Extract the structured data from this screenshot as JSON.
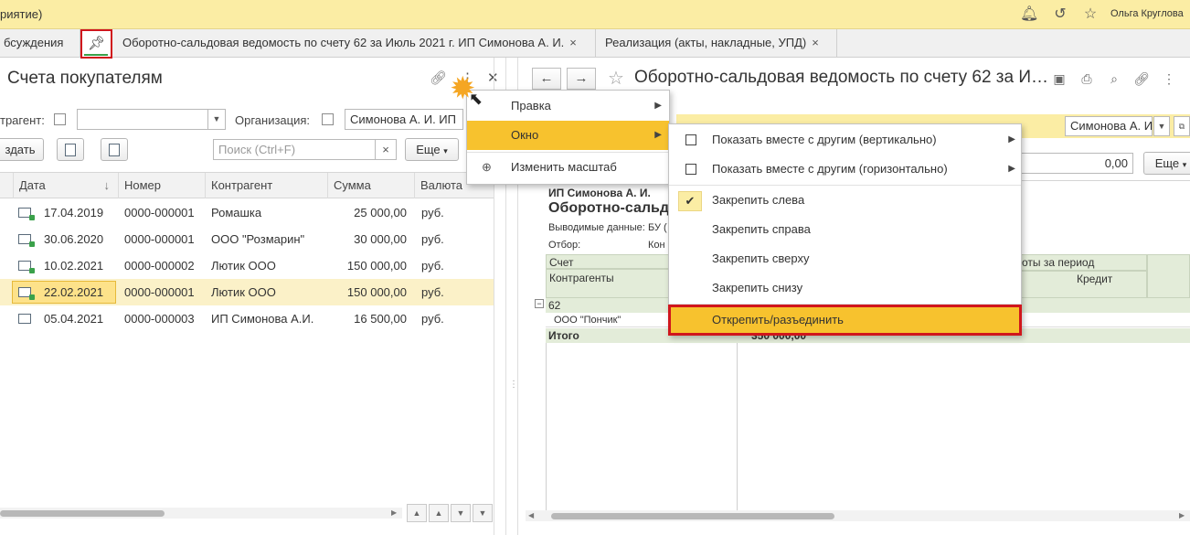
{
  "app": {
    "title_fragment": "риятие)",
    "user_name": "Ольга Круглова",
    "icons": [
      "bell-icon",
      "history-icon",
      "star-icon"
    ]
  },
  "tabs": [
    {
      "label": "бсуждения"
    },
    {
      "label": "Оборотно-сальдовая ведомость по счету 62 за Июль 2021 г. ИП Симонова А. И.",
      "close": "×"
    },
    {
      "label": "Реализация (акты, накладные, УПД)",
      "close": "×"
    }
  ],
  "left": {
    "title": "Счета покупателям",
    "filter": {
      "contractor_label": "трагент:",
      "org_label": "Организация:",
      "org_value": "Симонова А. И. ИП"
    },
    "create_label": "здать",
    "search_placeholder": "Поиск (Ctrl+F)",
    "search_clear": "×",
    "more_label": "Еще",
    "columns": [
      "Дата",
      "Номер",
      "Контрагент",
      "Сумма",
      "Валюта"
    ],
    "sort_arrow": "↓",
    "rows": [
      {
        "date": "17.04.2019",
        "number": "0000-000001",
        "contractor": "Ромашка",
        "sum": "25 000,00",
        "currency": "руб.",
        "posted": true
      },
      {
        "date": "30.06.2020",
        "number": "0000-000001",
        "contractor": "ООО \"Розмарин\"",
        "sum": "30 000,00",
        "currency": "руб.",
        "posted": true
      },
      {
        "date": "10.02.2021",
        "number": "0000-000002",
        "contractor": "Лютик ООО",
        "sum": "150 000,00",
        "currency": "руб.",
        "posted": true
      },
      {
        "date": "22.02.2021",
        "number": "0000-000001",
        "contractor": "Лютик ООО",
        "sum": "150 000,00",
        "currency": "руб.",
        "posted": true,
        "selected": true
      },
      {
        "date": "05.04.2021",
        "number": "0000-000003",
        "contractor": "ИП Симонова А.И.",
        "sum": "16 500,00",
        "currency": "руб.",
        "posted": false
      }
    ]
  },
  "right": {
    "title": "Оборотно-сальдовая ведомость по счету 62 за И…",
    "org_value": "Симонова А. И.",
    "amount": "0,00",
    "more_label": "Еще",
    "report": {
      "company": "ИП Симонова А. И.",
      "title": "Оборотно-сальд",
      "output_label": "Выводимые данные:",
      "output_value": "БУ (",
      "filter_label": "Отбор:",
      "filter_value": "Кон",
      "col_account": "Счет",
      "col_contractors": "Контрагенты",
      "col_turnover": "оты за период",
      "col_credit": "Кредит",
      "group_account": "62",
      "contractor_row": "ООО \"Пончик\"",
      "total_label": "Итого",
      "total_value": "350 000,00"
    }
  },
  "context_menu": {
    "items": [
      {
        "label": "Правка",
        "has_submenu": true
      },
      {
        "label": "Окно",
        "has_submenu": true,
        "active": true
      },
      {
        "label": "Изменить масштаб",
        "has_submenu": false
      }
    ]
  },
  "submenu": {
    "items": [
      {
        "label": "Показать вместе с другим (вертикально)",
        "has_submenu": true
      },
      {
        "label": "Показать вместе с другим (горизонтально)",
        "has_submenu": true
      },
      {
        "label": "Закрепить слева",
        "checked": true
      },
      {
        "label": "Закрепить справа"
      },
      {
        "label": "Закрепить сверху"
      },
      {
        "label": "Закрепить снизу"
      },
      {
        "label": "Открепить/разъединить",
        "highlighted": true
      }
    ]
  },
  "colors": {
    "topbar": "#fbeda4",
    "active_menu": "#f7c22e",
    "selected_row": "#fbf1c8",
    "highlight_border": "#d0161c",
    "report_header": "#e3ecd9"
  }
}
